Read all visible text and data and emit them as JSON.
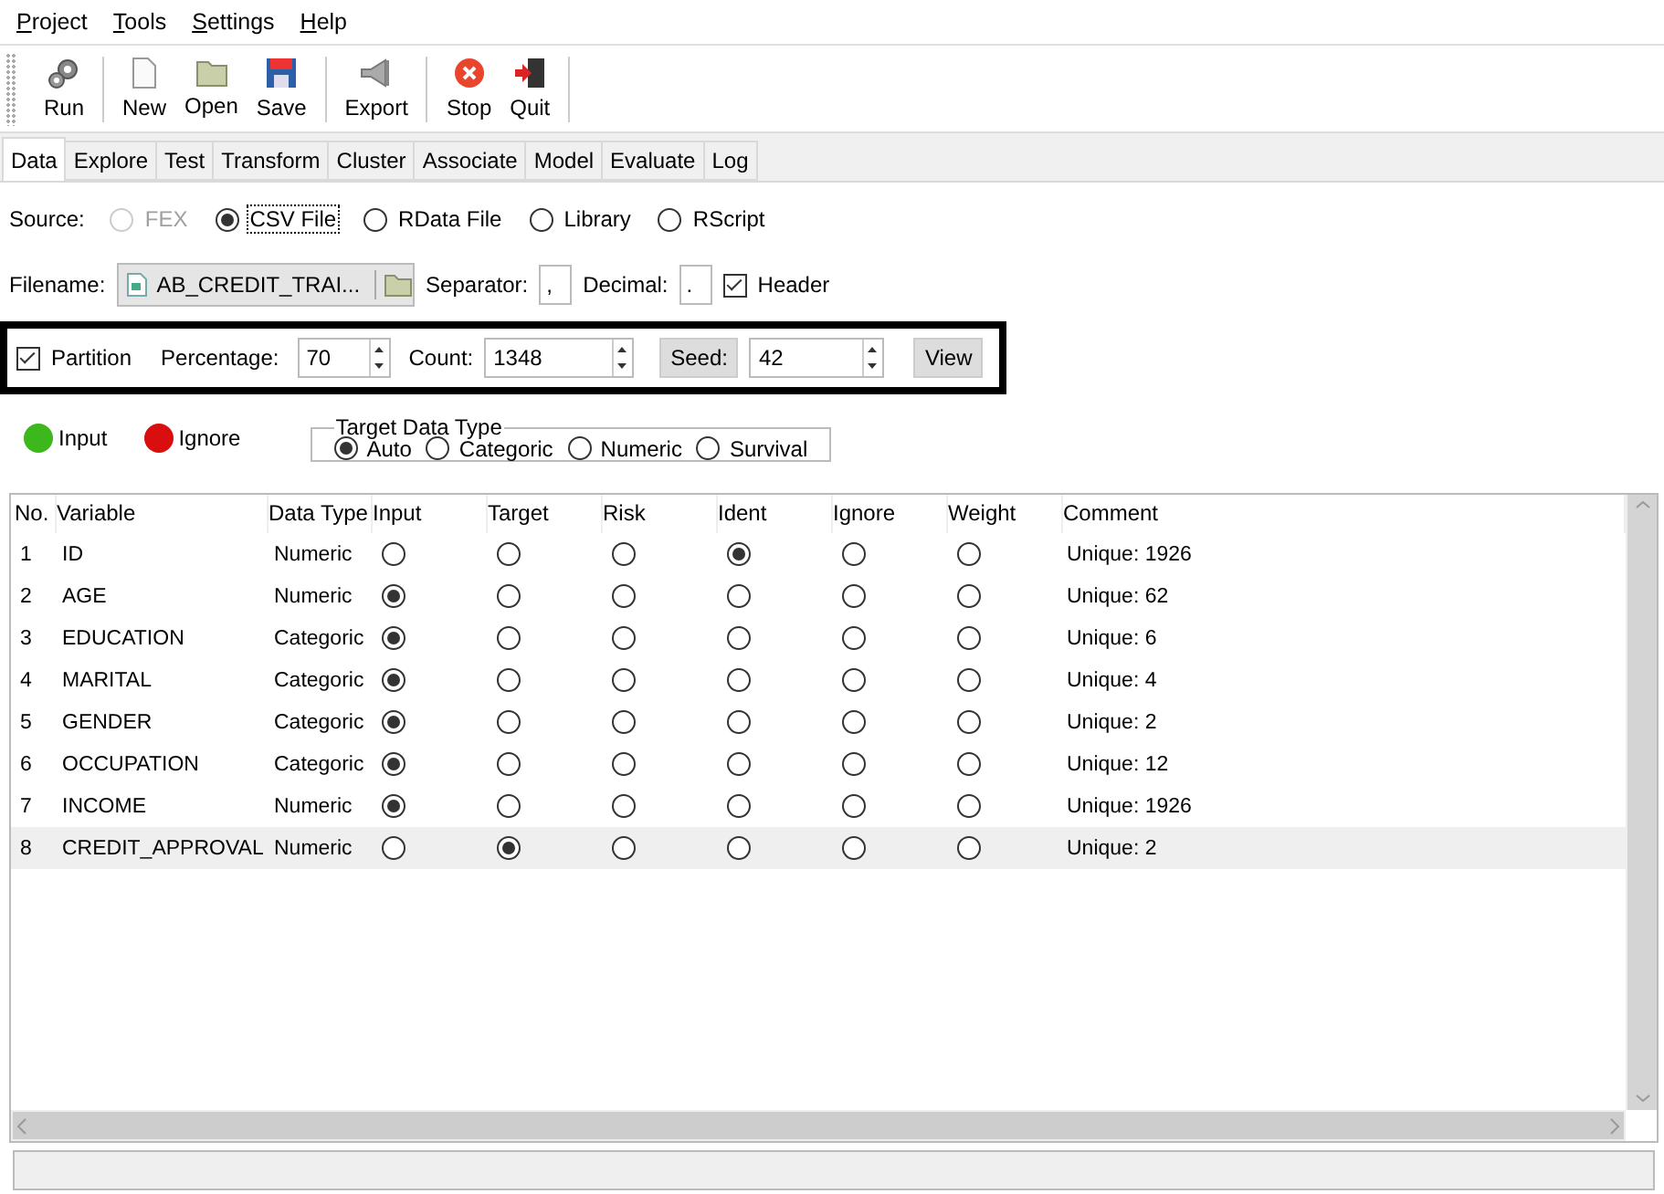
{
  "menu": [
    {
      "label": "Project"
    },
    {
      "label": "Tools"
    },
    {
      "label": "Settings"
    },
    {
      "label": "Help"
    }
  ],
  "toolbar": [
    [
      {
        "kind": "run",
        "label": "Run"
      }
    ],
    [
      {
        "kind": "new",
        "label": "New"
      },
      {
        "kind": "open",
        "label": "Open"
      },
      {
        "kind": "save",
        "label": "Save"
      }
    ],
    [
      {
        "kind": "export",
        "label": "Export"
      }
    ],
    [
      {
        "kind": "stop",
        "label": "Stop"
      },
      {
        "kind": "quit",
        "label": "Quit"
      }
    ]
  ],
  "tabs": [
    {
      "label": "Data",
      "selected": true
    },
    {
      "label": "Explore",
      "selected": false
    },
    {
      "label": "Test",
      "selected": false
    },
    {
      "label": "Transform",
      "selected": false
    },
    {
      "label": "Cluster",
      "selected": false
    },
    {
      "label": "Associate",
      "selected": false
    },
    {
      "label": "Model",
      "selected": false
    },
    {
      "label": "Evaluate",
      "selected": false
    },
    {
      "label": "Log",
      "selected": false
    }
  ],
  "source": {
    "label": "Source:",
    "options": [
      {
        "label": "FEX",
        "selected": false,
        "disabled": true
      },
      {
        "label": "CSV File",
        "selected": true,
        "disabled": false
      },
      {
        "label": "RData File",
        "selected": false,
        "disabled": false
      },
      {
        "label": "Library",
        "selected": false,
        "disabled": false
      },
      {
        "label": "RScript",
        "selected": false,
        "disabled": false
      }
    ]
  },
  "file": {
    "label": "Filename:",
    "value": "AB_CREDIT_TRAI...",
    "separator_label": "Separator:",
    "separator": ",",
    "decimal_label": "Decimal:",
    "decimal": ".",
    "header": {
      "label": "Header",
      "checked": true
    }
  },
  "partition": {
    "label": "Partition",
    "checked": true,
    "percentage_label": "Percentage:",
    "percentage": "70",
    "count_label": "Count:",
    "count": "1348",
    "seed_button": "Seed:",
    "seed": "42",
    "view_button": "View"
  },
  "legend": [
    {
      "label": "Input",
      "color": "#3cb81c"
    },
    {
      "label": "Ignore",
      "color": "#d90e0e"
    }
  ],
  "target_type": {
    "title": "Target Data Type",
    "options": [
      {
        "label": "Auto",
        "selected": true
      },
      {
        "label": "Categoric",
        "selected": false
      },
      {
        "label": "Numeric",
        "selected": false
      },
      {
        "label": "Survival",
        "selected": false
      }
    ]
  },
  "table": {
    "columns": [
      "No.",
      "Variable",
      "Data Type",
      "Input",
      "Target",
      "Risk",
      "Ident",
      "Ignore",
      "Weight",
      "Comment"
    ],
    "rows": [
      {
        "no": "1",
        "variable": "ID",
        "data_type": "Numeric",
        "roles": [
          {
            "selected": false
          },
          {
            "selected": false
          },
          {
            "selected": false
          },
          {
            "selected": true
          },
          {
            "selected": false
          },
          {
            "selected": false
          }
        ],
        "comment": "Unique: 1926",
        "highlighted": false
      },
      {
        "no": "2",
        "variable": "AGE",
        "data_type": "Numeric",
        "roles": [
          {
            "selected": true
          },
          {
            "selected": false
          },
          {
            "selected": false
          },
          {
            "selected": false
          },
          {
            "selected": false
          },
          {
            "selected": false
          }
        ],
        "comment": "Unique: 62",
        "highlighted": false
      },
      {
        "no": "3",
        "variable": "EDUCATION",
        "data_type": "Categoric",
        "roles": [
          {
            "selected": true
          },
          {
            "selected": false
          },
          {
            "selected": false
          },
          {
            "selected": false
          },
          {
            "selected": false
          },
          {
            "selected": false
          }
        ],
        "comment": "Unique: 6",
        "highlighted": false
      },
      {
        "no": "4",
        "variable": "MARITAL",
        "data_type": "Categoric",
        "roles": [
          {
            "selected": true
          },
          {
            "selected": false
          },
          {
            "selected": false
          },
          {
            "selected": false
          },
          {
            "selected": false
          },
          {
            "selected": false
          }
        ],
        "comment": "Unique: 4",
        "highlighted": false
      },
      {
        "no": "5",
        "variable": "GENDER",
        "data_type": "Categoric",
        "roles": [
          {
            "selected": true
          },
          {
            "selected": false
          },
          {
            "selected": false
          },
          {
            "selected": false
          },
          {
            "selected": false
          },
          {
            "selected": false
          }
        ],
        "comment": "Unique: 2",
        "highlighted": false
      },
      {
        "no": "6",
        "variable": "OCCUPATION",
        "data_type": "Categoric",
        "roles": [
          {
            "selected": true
          },
          {
            "selected": false
          },
          {
            "selected": false
          },
          {
            "selected": false
          },
          {
            "selected": false
          },
          {
            "selected": false
          }
        ],
        "comment": "Unique: 12",
        "highlighted": false
      },
      {
        "no": "7",
        "variable": "INCOME",
        "data_type": "Numeric",
        "roles": [
          {
            "selected": true
          },
          {
            "selected": false
          },
          {
            "selected": false
          },
          {
            "selected": false
          },
          {
            "selected": false
          },
          {
            "selected": false
          }
        ],
        "comment": "Unique: 1926",
        "highlighted": false
      },
      {
        "no": "8",
        "variable": "CREDIT_APPROVAL",
        "data_type": "Numeric",
        "roles": [
          {
            "selected": false
          },
          {
            "selected": true
          },
          {
            "selected": false
          },
          {
            "selected": false
          },
          {
            "selected": false
          },
          {
            "selected": false
          }
        ],
        "comment": "Unique: 2",
        "highlighted": true
      }
    ]
  }
}
